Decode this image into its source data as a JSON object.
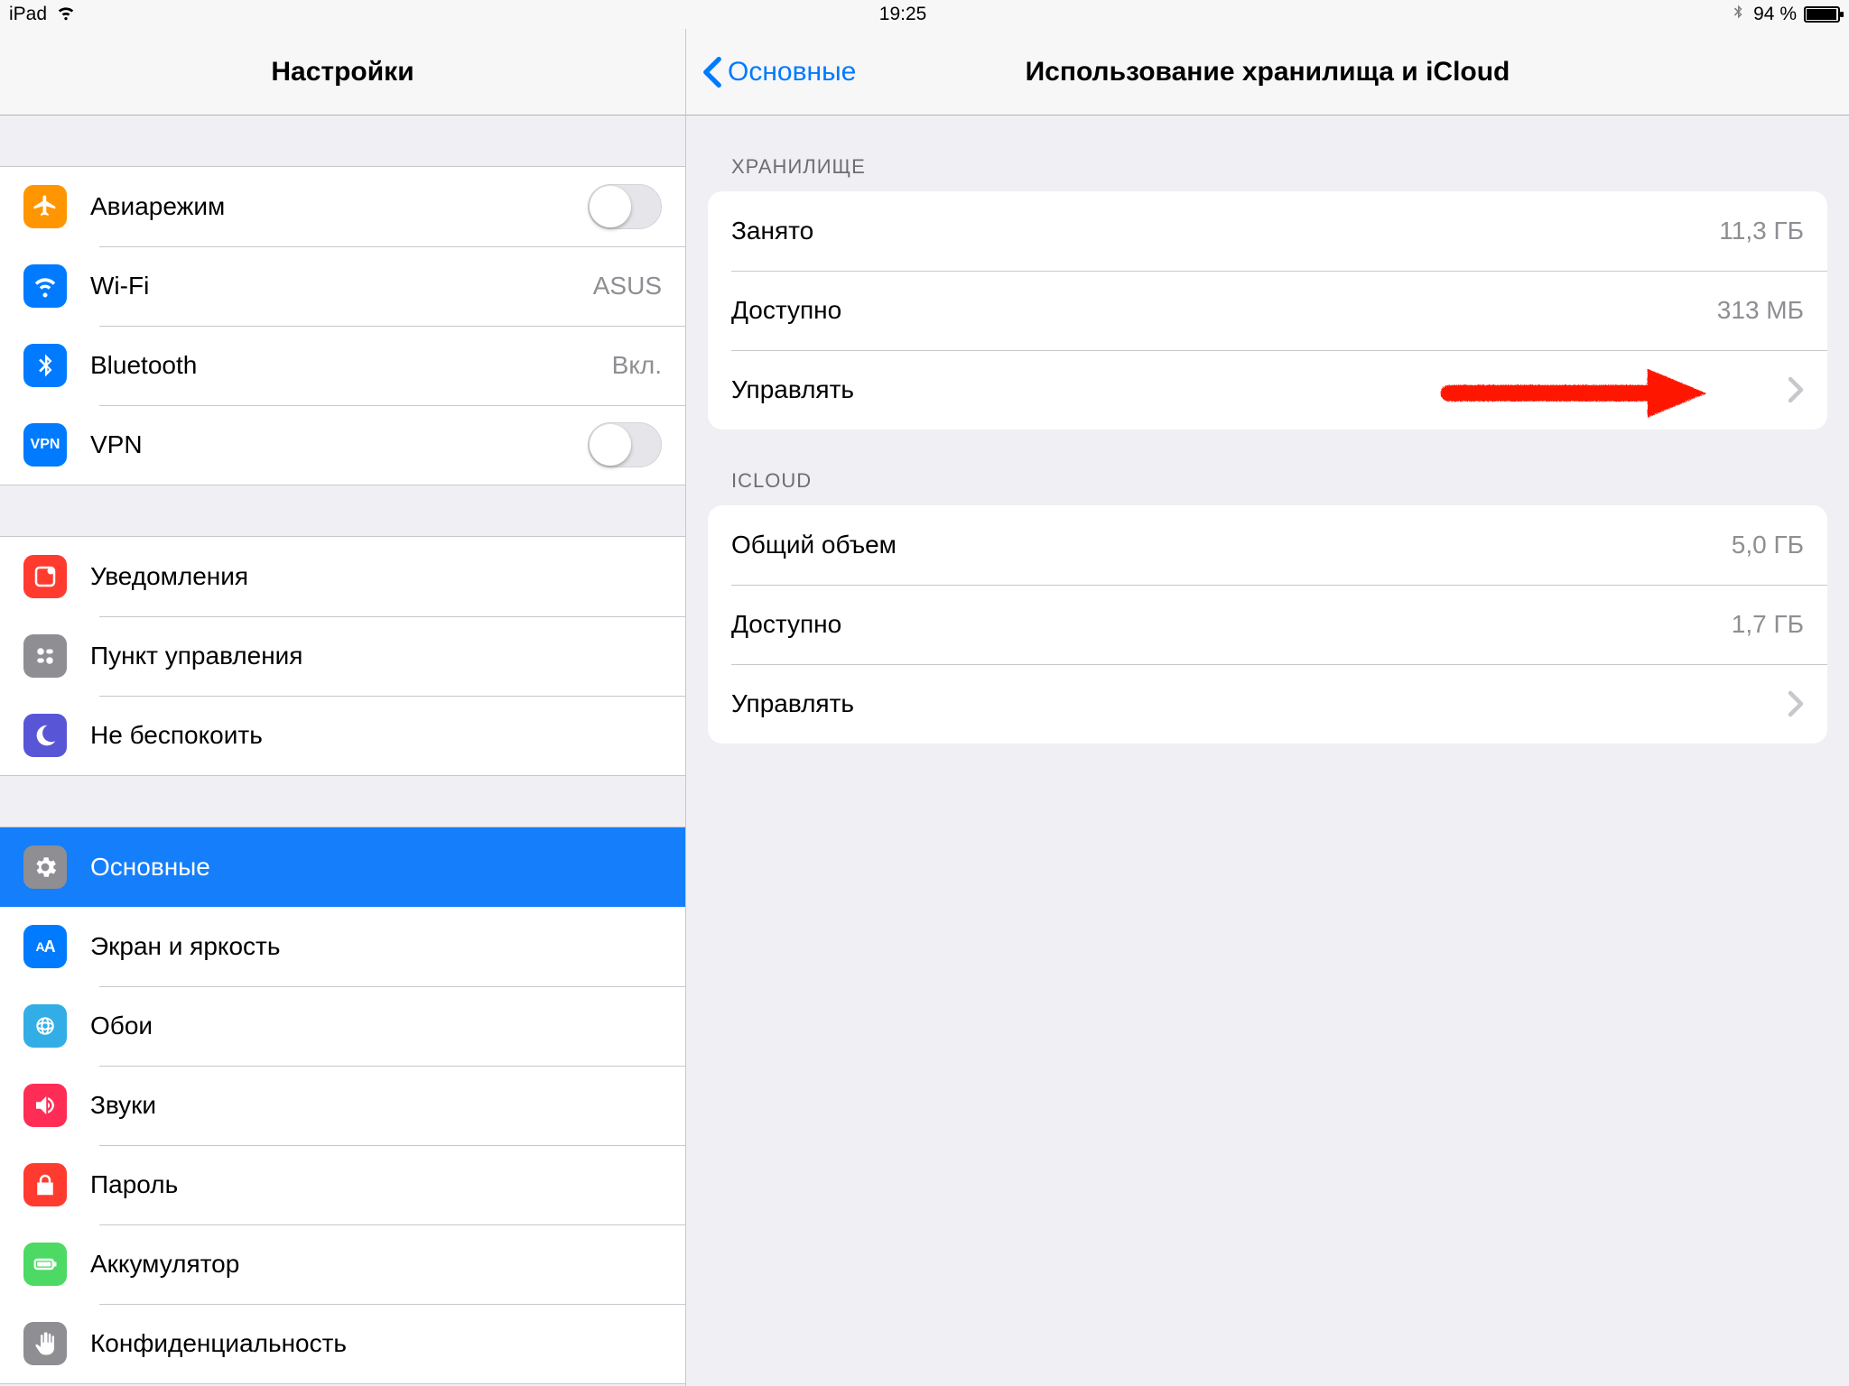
{
  "status": {
    "device": "iPad",
    "time": "19:25",
    "battery_pct": "94 %"
  },
  "sidebar": {
    "title": "Настройки",
    "items": {
      "airplane": "Авиарежим",
      "wifi": "Wi-Fi",
      "wifi_value": "ASUS",
      "bluetooth": "Bluetooth",
      "bluetooth_value": "Вкл.",
      "vpn": "VPN",
      "notifications": "Уведомления",
      "control_center": "Пункт управления",
      "dnd": "Не беспокоить",
      "general": "Основные",
      "display": "Экран и яркость",
      "wallpaper": "Обои",
      "sounds": "Звуки",
      "passcode": "Пароль",
      "battery": "Аккумулятор",
      "privacy": "Конфиденциальность"
    }
  },
  "detail": {
    "back": "Основные",
    "title": "Использование хранилища и iCloud",
    "storage": {
      "header": "ХРАНИЛИЩЕ",
      "used_label": "Занято",
      "used_value": "11,3 ГБ",
      "available_label": "Доступно",
      "available_value": "313 МБ",
      "manage_label": "Управлять"
    },
    "icloud": {
      "header": "ICLOUD",
      "total_label": "Общий объем",
      "total_value": "5,0 ГБ",
      "available_label": "Доступно",
      "available_value": "1,7 ГБ",
      "manage_label": "Управлять"
    }
  }
}
